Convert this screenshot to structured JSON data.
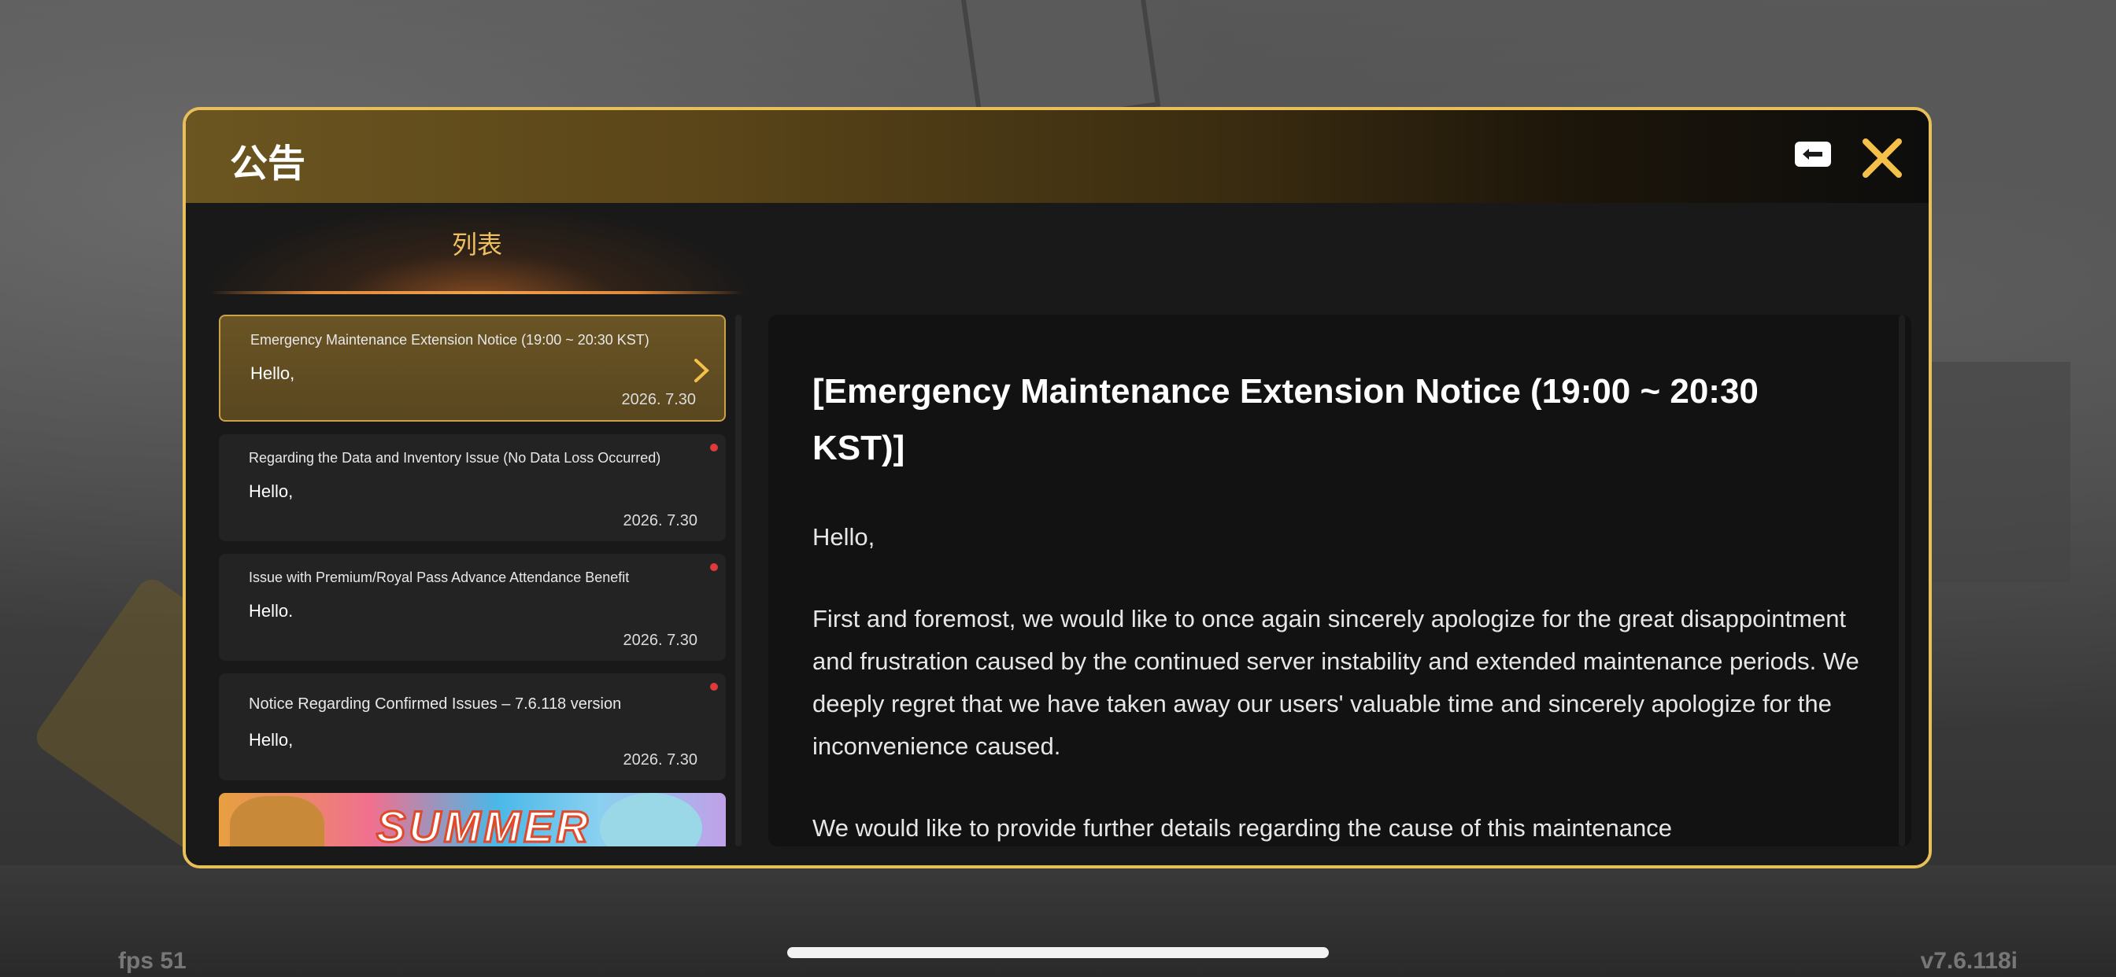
{
  "dialog": {
    "title": "公告"
  },
  "tab": {
    "label": "列表"
  },
  "notices": [
    {
      "title": "Emergency Maintenance Extension Notice (19:00 ~ 20:30 KST)",
      "preview": "Hello,",
      "date": "2026. 7.30",
      "selected": true,
      "unread": false
    },
    {
      "title": "Regarding the Data and Inventory Issue (No Data Loss Occurred)",
      "preview": "Hello,",
      "date": "2026. 7.30",
      "selected": false,
      "unread": true
    },
    {
      "title": "Issue with Premium/Royal Pass Advance Attendance Benefit",
      "preview": "Hello.",
      "date": "2026. 7.30",
      "selected": false,
      "unread": true
    },
    {
      "title": "Notice Regarding Confirmed Issues – 7.6.118 version",
      "preview": "Hello,",
      "date": "2026. 7.30",
      "selected": false,
      "unread": true
    }
  ],
  "banner": {
    "text": "SUMMER"
  },
  "content": {
    "title": "[Emergency Maintenance Extension Notice (19:00 ~ 20:30 KST)]",
    "greeting": "Hello,",
    "paragraph1": "First and foremost, we would like to once again sincerely apologize for the great disappointment and frustration caused by the continued server instability and extended maintenance periods. We deeply regret that we have taken away our users' valuable time and sincerely apologize for the inconvenience caused.",
    "paragraph2": "We would like to provide further details regarding the cause of this maintenance"
  },
  "background": {
    "fps": "fps 51",
    "version": "v7.6.118i"
  },
  "colors": {
    "accent": "#e8bf58",
    "unread_dot": "#e03b3b",
    "tab_text": "#f0c060"
  }
}
